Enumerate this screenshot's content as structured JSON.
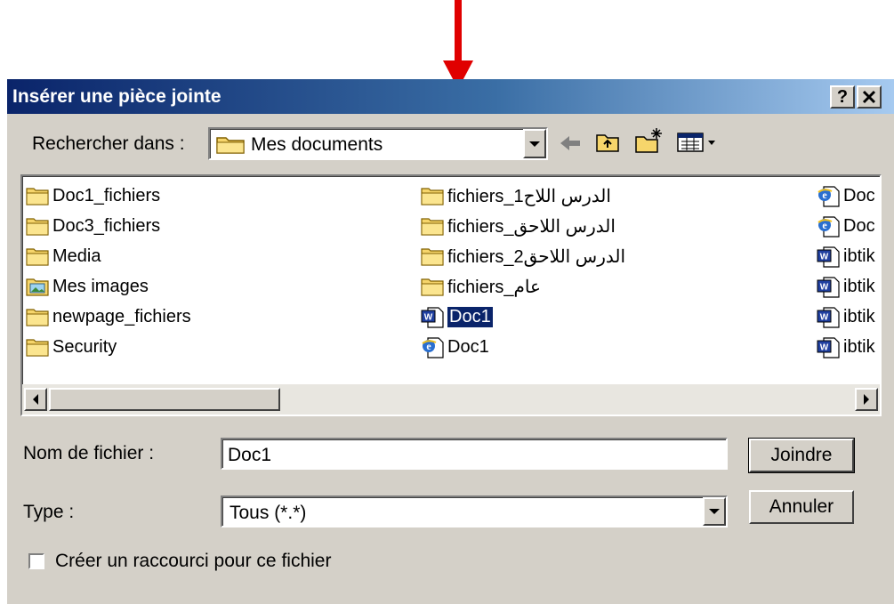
{
  "dialog": {
    "title": "Insérer une pièce jointe",
    "help_label": "?",
    "close_label": "✕"
  },
  "lookin": {
    "label": "Rechercher dans :",
    "value": "Mes documents"
  },
  "files": {
    "col1": [
      {
        "name": "Doc1_fichiers",
        "icon": "folder-icon"
      },
      {
        "name": "Doc3_fichiers",
        "icon": "folder-icon"
      },
      {
        "name": "Media",
        "icon": "folder-icon"
      },
      {
        "name": "Mes images",
        "icon": "pictures-folder-icon"
      },
      {
        "name": "newpage_fichiers",
        "icon": "folder-icon"
      },
      {
        "name": "Security",
        "icon": "folder-icon"
      }
    ],
    "col2": [
      {
        "name": "الدرس اللاح1_fichiers",
        "icon": "folder-icon"
      },
      {
        "name": "الدرس اللاحق_fichiers",
        "icon": "folder-icon"
      },
      {
        "name": "الدرس اللاحق2_fichiers",
        "icon": "folder-icon"
      },
      {
        "name": "عام_fichiers",
        "icon": "folder-icon"
      },
      {
        "name": "Doc1",
        "icon": "word-doc-icon",
        "selected": true
      },
      {
        "name": "Doc1",
        "icon": "ie-html-icon"
      }
    ],
    "col3": [
      {
        "name": "Doc",
        "icon": "ie-html-icon"
      },
      {
        "name": "Doc",
        "icon": "ie-html-icon"
      },
      {
        "name": "ibtik",
        "icon": "word-doc-icon"
      },
      {
        "name": "ibtik",
        "icon": "word-doc-icon"
      },
      {
        "name": "ibtik",
        "icon": "word-doc-icon"
      },
      {
        "name": "ibtik",
        "icon": "word-doc-icon"
      }
    ]
  },
  "filename": {
    "label": "Nom de fichier :",
    "value": "Doc1"
  },
  "filetype": {
    "label": "Type :",
    "value": "Tous (*.*)"
  },
  "buttons": {
    "attach": "Joindre",
    "cancel": "Annuler"
  },
  "shortcut": {
    "label": "Créer un raccourci pour ce fichier",
    "checked": false
  }
}
